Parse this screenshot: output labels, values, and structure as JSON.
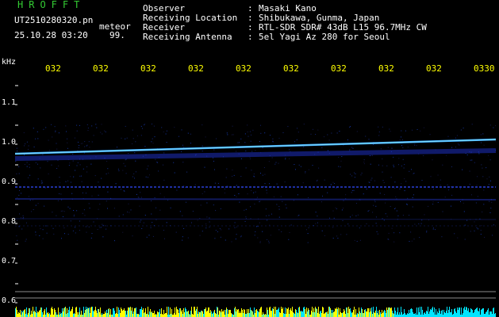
{
  "brand": "HROFFT",
  "file": {
    "name": "UT2510280320.pn",
    "suffix": "meteor",
    "datetime": "25.10.28 03:20",
    "value": "99."
  },
  "header": {
    "rows": [
      {
        "label": "Observer",
        "colon": ":",
        "value": "Masaki Kano"
      },
      {
        "label": "Receiving Location",
        "colon": ":",
        "value": "Shibukawa, Gunma, Japan"
      },
      {
        "label": "Receiver",
        "colon": ":",
        "value": "RTL-SDR SDR# 43dB L15 96.7MHz CW"
      },
      {
        "label": "Receiving Antenna",
        "colon": ":",
        "value": "5el Yagi Az 280 for Seoul"
      }
    ]
  },
  "axis": {
    "unit": "kHz",
    "time_labels": [
      "032",
      "032",
      "032",
      "032",
      "032",
      "032",
      "032",
      "032",
      "032",
      "0330"
    ],
    "freq_labels": [
      "1.1",
      "1.0",
      "0.9",
      "0.8",
      "0.7",
      "0.6"
    ]
  },
  "colors": {
    "background": "#000000",
    "text": "#ffffff",
    "time_labels": "#ffff00",
    "brand": "#33cc33",
    "trace": "#39a8ff",
    "band": "#1e2fbf",
    "baseline": "#ffff00"
  }
}
